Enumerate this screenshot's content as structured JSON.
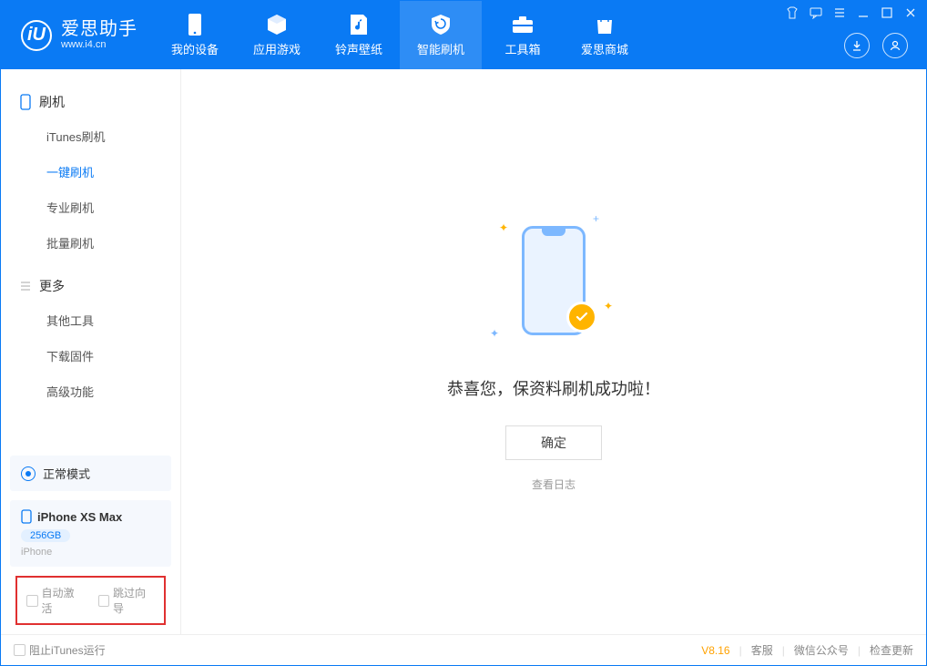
{
  "app": {
    "title": "爱思助手",
    "subtitle": "www.i4.cn"
  },
  "nav": {
    "tabs": [
      {
        "label": "我的设备"
      },
      {
        "label": "应用游戏"
      },
      {
        "label": "铃声壁纸"
      },
      {
        "label": "智能刷机"
      },
      {
        "label": "工具箱"
      },
      {
        "label": "爱思商城"
      }
    ]
  },
  "sidebar": {
    "section_flash": "刷机",
    "items_flash": [
      {
        "label": "iTunes刷机"
      },
      {
        "label": "一键刷机"
      },
      {
        "label": "专业刷机"
      },
      {
        "label": "批量刷机"
      }
    ],
    "section_more": "更多",
    "items_more": [
      {
        "label": "其他工具"
      },
      {
        "label": "下载固件"
      },
      {
        "label": "高级功能"
      }
    ],
    "mode_status": "正常模式",
    "device": {
      "name": "iPhone XS Max",
      "capacity": "256GB",
      "type": "iPhone"
    },
    "cb_auto_activate": "自动激活",
    "cb_skip_guide": "跳过向导"
  },
  "main": {
    "success_message": "恭喜您，保资料刷机成功啦！",
    "ok_button": "确定",
    "view_log": "查看日志"
  },
  "footer": {
    "block_itunes": "阻止iTunes运行",
    "version": "V8.16",
    "support": "客服",
    "wechat": "微信公众号",
    "check_update": "检查更新"
  }
}
